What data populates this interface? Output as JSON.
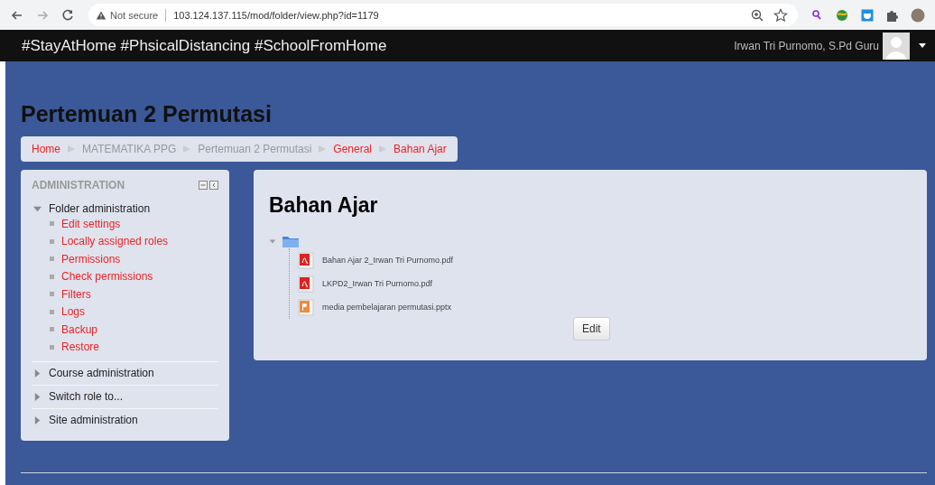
{
  "browser": {
    "security": "Not secure",
    "url": "103.124.137.115/mod/folder/view.php?id=1179"
  },
  "navbar": {
    "brand": "#StayAtHome #PhsicalDistancing #SchoolFromHome",
    "user": "Irwan Tri Purnomo, S.Pd Guru"
  },
  "page_title": "Pertemuan 2 Permutasi",
  "breadcrumb": [
    {
      "label": "Home",
      "link": true
    },
    {
      "label": "MATEMATIKA PPG",
      "link": false
    },
    {
      "label": "Pertemuan 2 Permutasi",
      "link": false
    },
    {
      "label": "General",
      "link": true
    },
    {
      "label": "Bahan Ajar",
      "link": true
    }
  ],
  "administration": {
    "title": "ADMINISTRATION",
    "items": [
      {
        "label": "Folder administration",
        "expanded": true,
        "children": [
          "Edit settings",
          "Locally assigned roles",
          "Permissions",
          "Check permissions",
          "Filters",
          "Logs",
          "Backup",
          "Restore"
        ]
      },
      {
        "label": "Course administration",
        "expanded": false
      },
      {
        "label": "Switch role to...",
        "expanded": false
      },
      {
        "label": "Site administration",
        "expanded": false
      }
    ]
  },
  "content": {
    "heading": "Bahan Ajar",
    "folder_expanded": true,
    "files": [
      {
        "name": "Bahan Ajar 2_Irwan Tri Purnomo.pdf",
        "kind": "pdf"
      },
      {
        "name": "LKPD2_Irwan Tri Purnomo.pdf",
        "kind": "pdf"
      },
      {
        "name": "media pembelajaran permutasi.pptx",
        "kind": "pptx"
      }
    ],
    "button": "Edit"
  }
}
